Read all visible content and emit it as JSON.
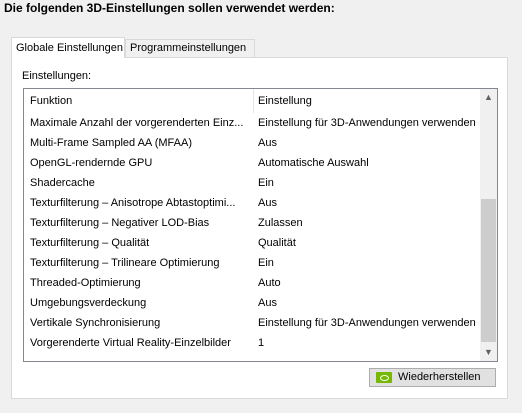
{
  "heading": "Die folgenden 3D-Einstellungen sollen verwendet werden:",
  "tabs": [
    {
      "label": "Globale Einstellungen",
      "active": true
    },
    {
      "label": "Programmeinstellungen",
      "active": false
    }
  ],
  "panel": {
    "label": "Einstellungen:",
    "columns": [
      "Funktion",
      "Einstellung"
    ],
    "rows": [
      {
        "function": "Maximale Anzahl der vorgerenderten Einz...",
        "setting": "Einstellung für 3D-Anwendungen verwenden"
      },
      {
        "function": "Multi-Frame Sampled AA (MFAA)",
        "setting": "Aus"
      },
      {
        "function": "OpenGL-rendernde GPU",
        "setting": "Automatische Auswahl"
      },
      {
        "function": "Shadercache",
        "setting": "Ein"
      },
      {
        "function": "Texturfilterung – Anisotrope Abtastoptimi...",
        "setting": "Aus"
      },
      {
        "function": "Texturfilterung – Negativer LOD-Bias",
        "setting": "Zulassen"
      },
      {
        "function": "Texturfilterung – Qualität",
        "setting": "Qualität"
      },
      {
        "function": "Texturfilterung – Trilineare Optimierung",
        "setting": "Ein"
      },
      {
        "function": "Threaded-Optimierung",
        "setting": "Auto"
      },
      {
        "function": "Umgebungsverdeckung",
        "setting": "Aus"
      },
      {
        "function": "Vertikale Synchronisierung",
        "setting": "Einstellung für 3D-Anwendungen verwenden"
      },
      {
        "function": "Vorgerenderte Virtual Reality-Einzelbilder",
        "setting": "1"
      }
    ]
  },
  "restore_button": {
    "label": "Wiederherstellen",
    "icon": "nvidia-logo-icon"
  },
  "colors": {
    "nvidia_green": "#76b900",
    "window_bg": "#f0f0f0"
  }
}
